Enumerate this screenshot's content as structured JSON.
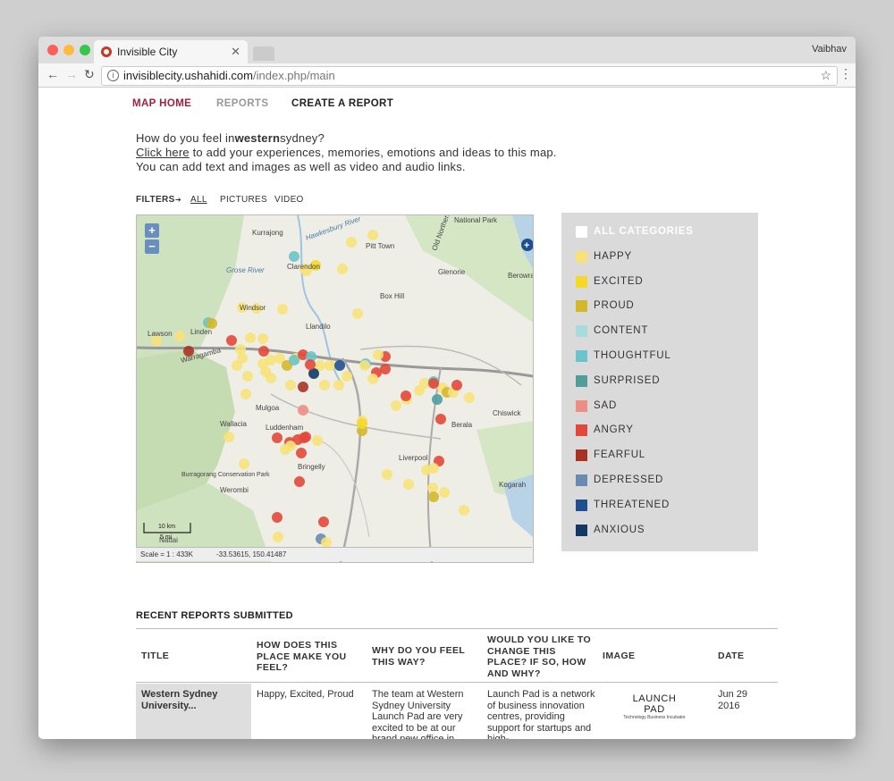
{
  "browser": {
    "tab_title": "Invisible City",
    "user": "Vaibhav",
    "url_host": "invisiblecity.ushahidi.com",
    "url_path": "/index.php/main"
  },
  "nav": {
    "items": [
      {
        "label": "MAP HOME",
        "color": "#a3203f"
      },
      {
        "label": "REPORTS",
        "color": "#999999"
      },
      {
        "label": "CREATE A REPORT",
        "color": "#222222"
      }
    ]
  },
  "intro": {
    "line1_pre": "How do you feel in",
    "line1_bold": "western",
    "line1_post": "sydney?",
    "link_text": "Click here",
    "line2_post": " to add your experiences, memories, emotions and ideas to this map.",
    "line3": "You can add text and images as well as video and audio links."
  },
  "filters": {
    "label": "FILTERS",
    "arrow": "➔",
    "options": [
      "ALL",
      "PICTURES",
      "VIDEO"
    ]
  },
  "map": {
    "place_labels": [
      "Kurrajong",
      "Pitt Town",
      "Clarendon",
      "Old Northern",
      "National Park",
      "Glenorie",
      "Berowra",
      "Box Hill",
      "Windsor",
      "Llandilo",
      "Lawson",
      "Linden",
      "Mulgoa",
      "Wallacia",
      "Luddenham",
      "Bringelly",
      "Berala",
      "Chiswick",
      "Liverpool",
      "Kogarah",
      "Warragamba",
      "Burragorang Conservation Park",
      "Werombi",
      "Nattai",
      "Grose River",
      "Hawkesbury River"
    ],
    "scale_km": "10 km",
    "scale_mi": "5 mi",
    "status_scale": "Scale = 1 : 433K",
    "status_coords": "-33.53615, 150.41487",
    "zoom_in": "+",
    "zoom_out": "−"
  },
  "legend": {
    "items": [
      {
        "label": "ALL CATEGORIES",
        "color": "#ffffff"
      },
      {
        "label": "HAPPY",
        "color": "#f7e27a"
      },
      {
        "label": "EXCITED",
        "color": "#f5d829"
      },
      {
        "label": "PROUD",
        "color": "#d4b82b"
      },
      {
        "label": "CONTENT",
        "color": "#a7dcdc"
      },
      {
        "label": "THOUGHTFUL",
        "color": "#6cc3c9"
      },
      {
        "label": "SURPRISED",
        "color": "#4f9e9a"
      },
      {
        "label": "SAD",
        "color": "#ed8e86"
      },
      {
        "label": "ANGRY",
        "color": "#e2483a"
      },
      {
        "label": "FEARFUL",
        "color": "#a93226"
      },
      {
        "label": "DEPRESSED",
        "color": "#6a8ab3"
      },
      {
        "label": "THREATENED",
        "color": "#1f4f8f"
      },
      {
        "label": "ANXIOUS",
        "color": "#123863"
      }
    ]
  },
  "recent": {
    "title": "RECENT REPORTS SUBMITTED",
    "columns": [
      "TITLE",
      "HOW DOES THIS PLACE MAKE YOU FEEL?",
      "WHY DO YOU FEEL THIS WAY?",
      "WOULD YOU LIKE TO CHANGE THIS PLACE? IF SO, HOW AND WHY?",
      "IMAGE",
      "DATE"
    ],
    "rows": [
      {
        "title": "Western Sydney University...",
        "feel": "Happy, Excited, Proud",
        "why": "The team at Western Sydney University Launch Pad are very excited to be at our brand new office in",
        "change": "Launch Pad is a network of business innovation centres, providing support for startups and high-",
        "image_logo": "LAUNCH PAD",
        "image_caption": "Technology Business Incubator",
        "date": "Jun 29 2016"
      }
    ]
  }
}
